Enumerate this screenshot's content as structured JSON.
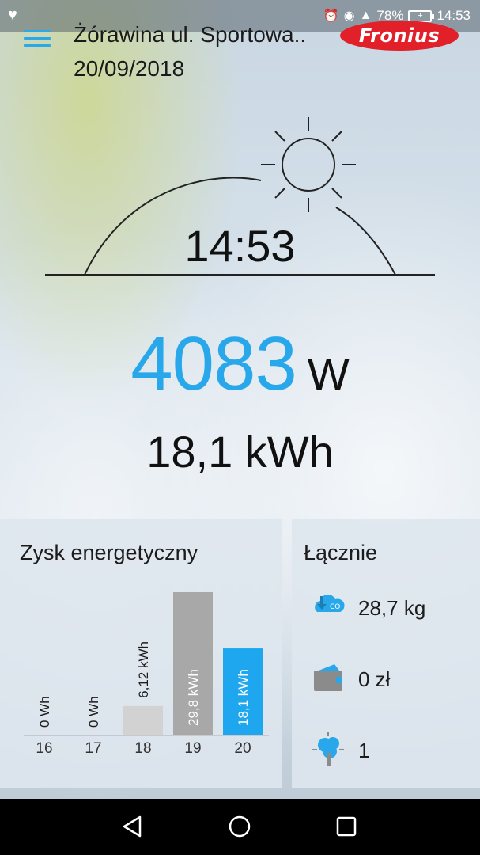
{
  "status_bar": {
    "left_icon": "heart-pulse-icon",
    "icons": [
      "alarm-icon",
      "eye-icon",
      "lte-signal-icon"
    ],
    "battery_percent": "78%",
    "time": "14:53"
  },
  "header": {
    "menu_icon": "hamburger-menu-icon",
    "site_name": "Żórawina ul. Sportowa..",
    "date": "20/09/2018",
    "logo_text": "Fronius",
    "logo_color": "#e2202a"
  },
  "hero": {
    "time": "14:53",
    "power_value": "4083",
    "power_unit": "W",
    "energy_today": "18,1 kWh",
    "accent_color": "#28a8ea"
  },
  "energy_panel": {
    "title": "Zysk energetyczny"
  },
  "chart_data": {
    "type": "bar",
    "categories": [
      "16",
      "17",
      "18",
      "19",
      "20"
    ],
    "values": [
      0,
      0,
      6.12,
      29.8,
      18.1
    ],
    "data_labels": [
      "0 Wh",
      "0 Wh",
      "6,12 kWh",
      "29,8 kWh",
      "18,1 kWh"
    ],
    "ylim": [
      0,
      29.8
    ],
    "highlight_index": 4,
    "highlight_color": "#1ea7ef",
    "bar_colors": [
      "#c8c8c8",
      "#c8c8c8",
      "#d2d2d2",
      "#a8a8a8",
      "#1ea7ef"
    ],
    "grid": false
  },
  "totals_panel": {
    "title": "Łącznie",
    "items": [
      {
        "icon": "co2-cloud-icon",
        "value": "28,7 kg"
      },
      {
        "icon": "wallet-co2-icon",
        "value": "0 zł"
      },
      {
        "icon": "tree-icon",
        "value": "1"
      }
    ]
  },
  "nav_bar": {
    "buttons": [
      "back-icon",
      "home-icon",
      "recents-icon"
    ]
  }
}
